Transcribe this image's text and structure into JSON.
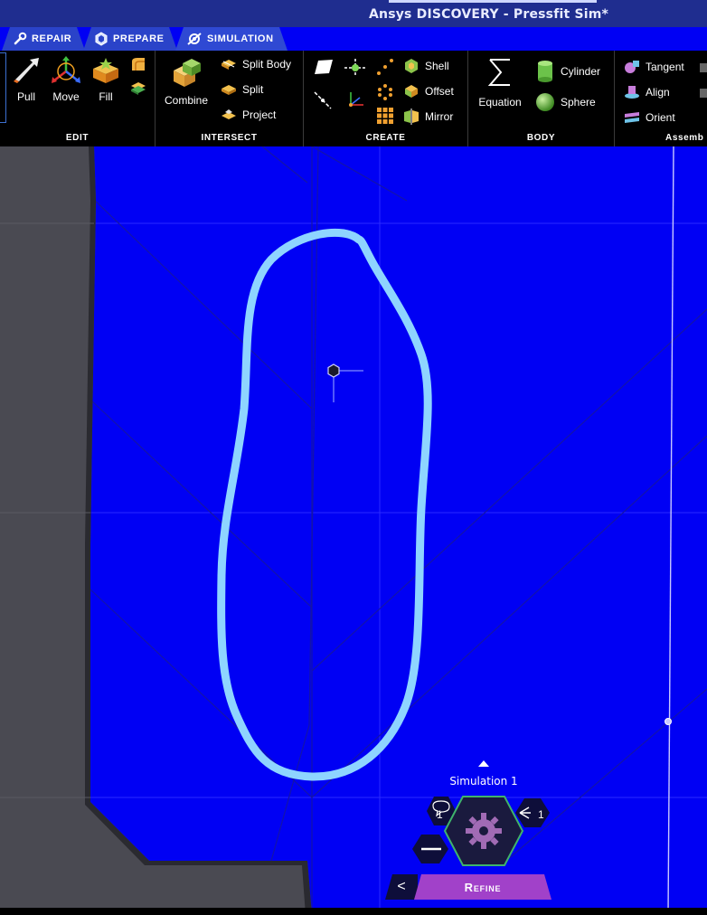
{
  "window": {
    "title": "Ansys DISCOVERY - Pressfit Sim*"
  },
  "tabs": [
    {
      "label": "Repair",
      "icon": "wrench-icon"
    },
    {
      "label": "Prepare",
      "icon": "cube-icon"
    },
    {
      "label": "Simulation",
      "icon": "simulation-icon"
    }
  ],
  "ribbon": {
    "edit": {
      "label": "Edit",
      "pull": "Pull",
      "move": "Move",
      "fill": "Fill"
    },
    "intersect": {
      "label": "Intersect",
      "combine": "Combine",
      "split_body": "Split Body",
      "split": "Split",
      "project": "Project"
    },
    "create": {
      "label": "Create",
      "shell": "Shell",
      "offset": "Offset",
      "mirror": "Mirror"
    },
    "body": {
      "label": "Body",
      "equation": "Equation",
      "cylinder": "Cylinder",
      "sphere": "Sphere"
    },
    "assembly": {
      "label": "Assemb",
      "tangent": "Tangent",
      "align": "Align",
      "orient": "Orient"
    }
  },
  "selection_panel": {
    "simulation_label": "Simulation 1",
    "comment_count": "1",
    "branch_count": "1",
    "refine_label": "Refine",
    "back_glyph": "<"
  },
  "colors": {
    "viewport_blue": "#0000f4",
    "highlight_stroke": "#8ed4ff",
    "tab_blue": "#2a43c9",
    "refine_purple": "#a141c9",
    "body_gray": "#4a4a52"
  }
}
